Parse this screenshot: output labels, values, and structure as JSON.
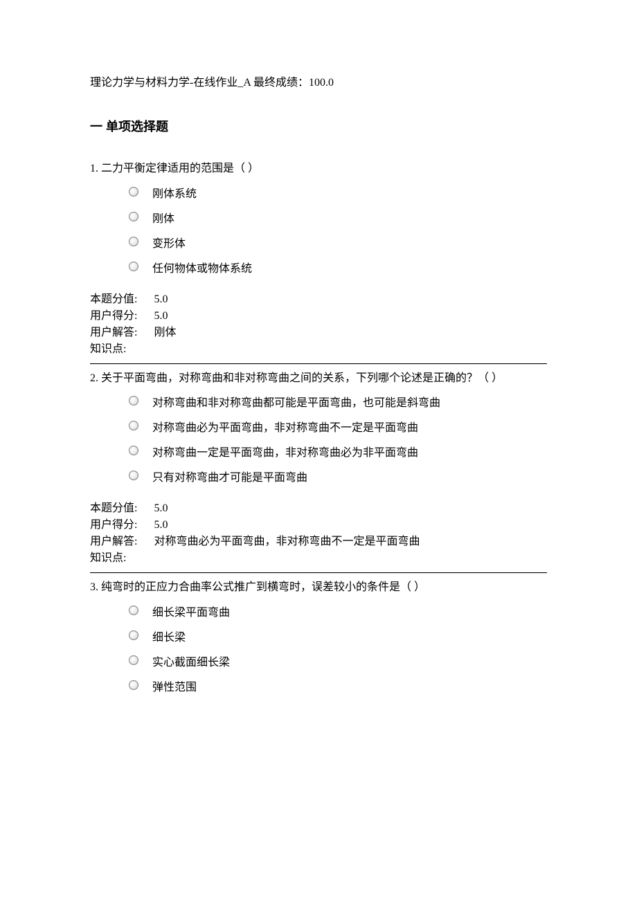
{
  "header": "理论力学与材料力学-在线作业_A 最终成绩：100.0",
  "section_title": "一  单项选择题",
  "questions": [
    {
      "number": "1.",
      "text": "二力平衡定律适用的范围是（  ）",
      "options": [
        "刚体系统",
        "刚体",
        "变形体",
        "任何物体或物体系统"
      ],
      "meta": {
        "score_label": "本题分值:",
        "score_value": "5.0",
        "user_score_label": "用户得分:",
        "user_score_value": "5.0",
        "user_answer_label": "用户解答:",
        "user_answer_value": "刚体",
        "kp_label": "知识点:",
        "kp_value": ""
      }
    },
    {
      "number": "2.",
      "text": "关于平面弯曲，对称弯曲和非对称弯曲之间的关系，下列哪个论述是正确的？（  ）",
      "options": [
        "对称弯曲和非对称弯曲都可能是平面弯曲，也可能是斜弯曲",
        "对称弯曲必为平面弯曲，非对称弯曲不一定是平面弯曲",
        "对称弯曲一定是平面弯曲，非对称弯曲必为非平面弯曲",
        "只有对称弯曲才可能是平面弯曲"
      ],
      "meta": {
        "score_label": "本题分值:",
        "score_value": "5.0",
        "user_score_label": "用户得分:",
        "user_score_value": "5.0",
        "user_answer_label": "用户解答:",
        "user_answer_value": "对称弯曲必为平面弯曲，非对称弯曲不一定是平面弯曲",
        "kp_label": "知识点:",
        "kp_value": ""
      }
    },
    {
      "number": "3.",
      "text": "纯弯时的正应力合曲率公式推广到横弯时，误差较小的条件是（  ）",
      "options": [
        "细长梁平面弯曲",
        "细长梁",
        "实心截面细长梁",
        "弹性范围"
      ],
      "meta": null
    }
  ]
}
